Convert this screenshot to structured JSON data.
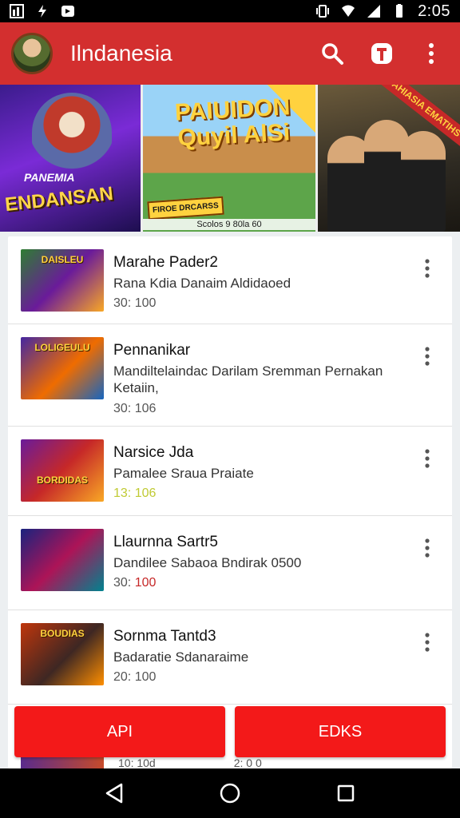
{
  "status_bar": {
    "time": "2:05",
    "icons": [
      "notification-icon",
      "flash-icon",
      "message-icon",
      "vibrate-icon",
      "wifi-icon",
      "signal-icon",
      "battery-icon"
    ]
  },
  "app_bar": {
    "title": "Ilndanesia",
    "actions": [
      "search-icon",
      "logo-icon",
      "more-vert-icon"
    ],
    "color": "#d32f2f"
  },
  "banner": {
    "tiles": [
      {
        "title": "ENDANSAN",
        "subtitle": "PANEMIA"
      },
      {
        "title": "PAIUIDON Quyil AlSi",
        "badge": "FIROE DRCARSS",
        "strip": "Scolos 9 80la 60"
      },
      {
        "ribbon": "FAHIASIA EMATIHS"
      }
    ]
  },
  "list": {
    "items": [
      {
        "title": "Marahe Pader2",
        "desc": "Rana Kdia Danaim Aldidaoed",
        "meta": "30: 100",
        "meta_style": "normal",
        "thumb_text": "DAISLEU"
      },
      {
        "title": "Pennanikar",
        "desc": "Mandiltelaindac Darilam Sremman Pernakan Ketaiin,",
        "meta": "30: 106",
        "meta_style": "normal",
        "thumb_text": "LOLIGEULU"
      },
      {
        "title": "Narsice Jda",
        "desc": "Pamalee Sraua Praiate",
        "meta": "13: 106",
        "meta_style": "green",
        "thumb_text": "BORDIDAS"
      },
      {
        "title": "Llaurnna Sartr5",
        "desc": "Dandilee Sabaoa Bndirak 0500",
        "meta_prefix": "30: ",
        "meta": "100",
        "meta_style": "red",
        "thumb_text": ""
      },
      {
        "title": "Sornma Tantd3",
        "desc": "Badaratie Sdanaraime",
        "meta": "20: 100",
        "meta_style": "normal",
        "thumb_text": "BOUDIAS"
      }
    ]
  },
  "buttons": {
    "left_label": "API",
    "right_label": "EDKS",
    "color": "#f31919"
  },
  "partial_row": {
    "meta_left": "10: 10d",
    "meta_right": "2: 0 0"
  },
  "nav_bar": {
    "icons": [
      "back-icon",
      "home-icon",
      "recents-icon"
    ]
  }
}
